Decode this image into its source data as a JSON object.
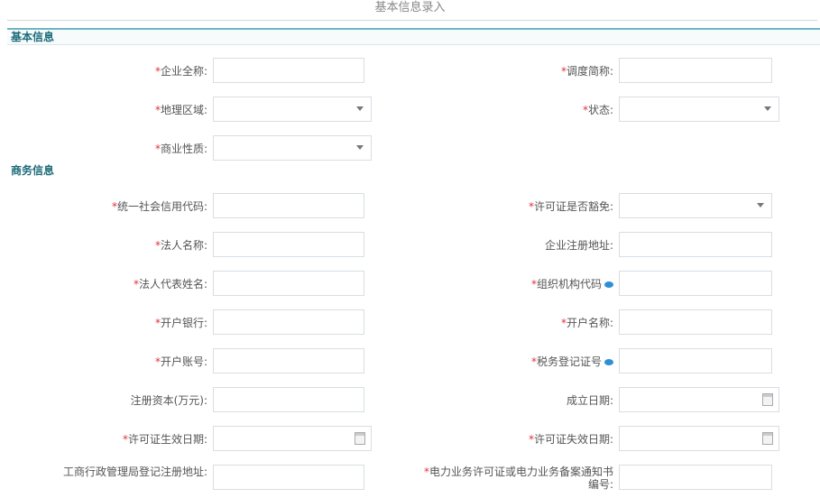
{
  "page": {
    "title": "基本信息录入"
  },
  "sections": {
    "basic": "基本信息",
    "business": "商务信息"
  },
  "required_mark": "*",
  "basic": {
    "company_fullname": {
      "label": "企业全称",
      "value": ""
    },
    "short_name": {
      "label": "调度简称",
      "value": ""
    },
    "region": {
      "label": "地理区域",
      "value": ""
    },
    "status": {
      "label": "状态",
      "value": ""
    },
    "industry": {
      "label": "商业性质",
      "value": ""
    }
  },
  "business": {
    "credit_code": {
      "label": "统一社会信用代码",
      "value": ""
    },
    "license_type": {
      "label": "许可证是否豁免",
      "value": ""
    },
    "legal_name": {
      "label": "法人名称",
      "value": ""
    },
    "reg_address": {
      "label": "企业注册地址",
      "value": ""
    },
    "legal_rep": {
      "label": "法人代表姓名",
      "value": ""
    },
    "org_code": {
      "label": "组织机构代码",
      "value": ""
    },
    "bank": {
      "label": "开户银行",
      "value": ""
    },
    "account_name": {
      "label": "开户名称",
      "value": ""
    },
    "account_no": {
      "label": "开户账号",
      "value": ""
    },
    "tax_no": {
      "label": "税务登记证号",
      "value": ""
    },
    "capital": {
      "label": "注册资本(万元)",
      "value": ""
    },
    "found_date": {
      "label": "成立日期",
      "value": ""
    },
    "license_valid": {
      "label": "许可证生效日期",
      "value": ""
    },
    "license_expire": {
      "label": "许可证失效日期",
      "value": ""
    },
    "aic_address": {
      "label": "工商行政管理局登记注册地址",
      "value": ""
    },
    "power_license": {
      "label": "电力业务许可证或电力业务备案通知书编号",
      "value": ""
    }
  }
}
